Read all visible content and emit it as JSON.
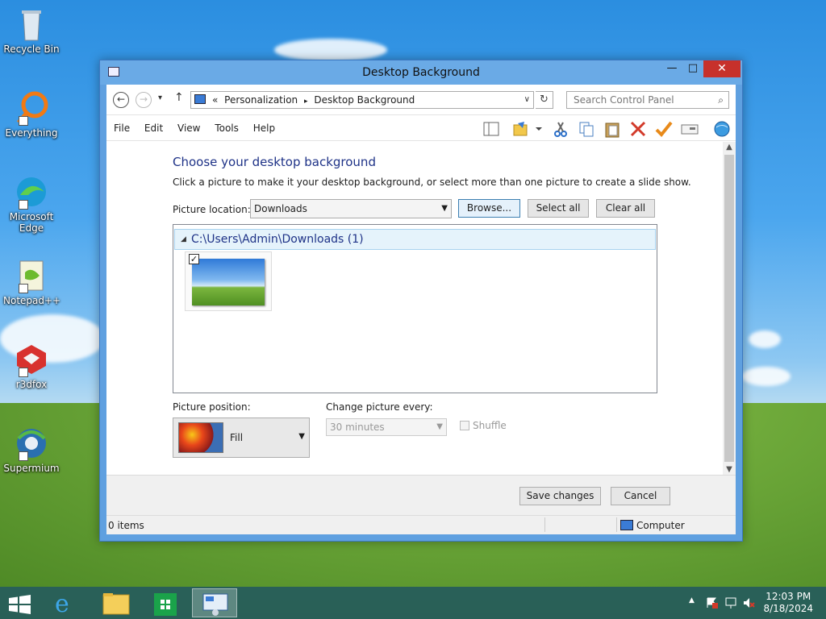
{
  "desktop": {
    "icons": [
      {
        "label": "Recycle Bin"
      },
      {
        "label": "Everything"
      },
      {
        "label": "Microsoft Edge"
      },
      {
        "label": "Notepad++"
      },
      {
        "label": "r3dfox"
      },
      {
        "label": "Supermium"
      }
    ]
  },
  "window": {
    "title": "Desktop Background",
    "minimize": "—",
    "maximize": "□",
    "close": "✕"
  },
  "address": {
    "back": "←",
    "forward": "→",
    "recent": "▾",
    "up": "↑",
    "overflow": "«",
    "crumbs": [
      "Personalization",
      "Desktop Background"
    ],
    "separator": "▸",
    "dropdown": "∨",
    "refresh": "↻",
    "search_placeholder": "Search Control Panel",
    "search_icon": "⌕"
  },
  "menu": [
    "File",
    "Edit",
    "View",
    "Tools",
    "Help"
  ],
  "toolbar_icons": [
    "layout-icon",
    "folder-options-icon",
    "dropdown-icon",
    "cut-icon",
    "copy-icon",
    "paste-icon",
    "delete-icon",
    "check-icon",
    "properties-icon",
    "globe-icon"
  ],
  "content": {
    "heading": "Choose your desktop background",
    "subtitle": "Click a picture to make it your desktop background, or select more than one picture to create a slide show.",
    "location_label": "Picture location:",
    "location_value": "Downloads",
    "browse": "Browse...",
    "select_all": "Select all",
    "clear_all": "Clear all",
    "group_label": "C:\\Users\\Admin\\Downloads (1)",
    "thumbnail_checked": "✓",
    "position_label": "Picture position:",
    "position_value": "Fill",
    "change_label": "Change picture every:",
    "change_value": "30 minutes",
    "shuffle": "Shuffle",
    "save": "Save changes",
    "cancel": "Cancel"
  },
  "status": {
    "items": "0 items",
    "location": "Computer"
  },
  "taskbar": {
    "time": "12:03 PM",
    "date": "8/18/2024",
    "icons": [
      "start-icon",
      "internet-explorer-icon",
      "file-explorer-icon",
      "store-icon",
      "control-panel-icon"
    ]
  },
  "colors": {
    "accent": "#1e3287",
    "title_bar": "#6aaae6",
    "close_button": "#c7312b",
    "taskbar": "#265c5c"
  }
}
